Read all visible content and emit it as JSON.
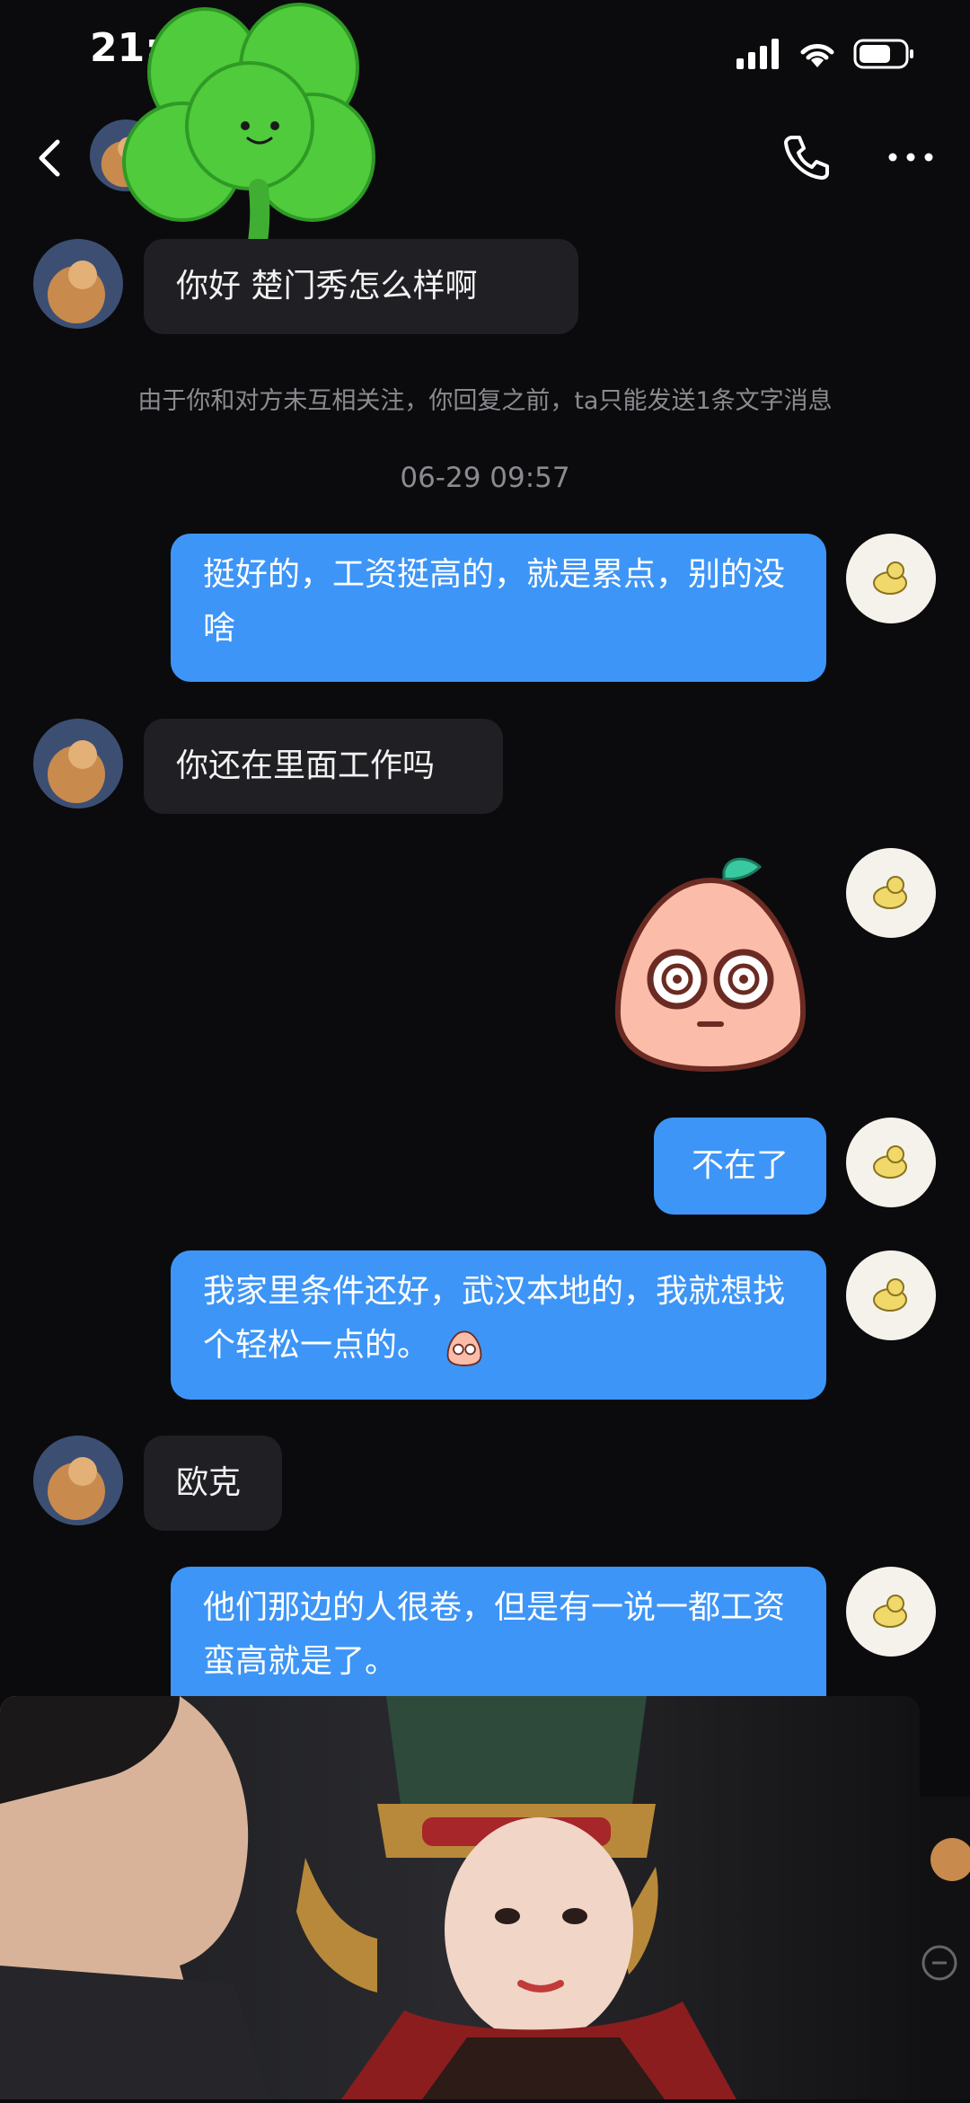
{
  "status_bar": {
    "time": "21:"
  },
  "messages": {
    "incoming_1": "你好 楚门秀怎么样啊",
    "incoming_2": "你还在里面工作吗",
    "incoming_3": "欧克",
    "outgoing_1": "挺好的，工资挺高的，就是累点，别的没啥",
    "outgoing_2": "不在了",
    "outgoing_3": "我家里条件还好，武汉本地的，我就想找个轻松一点的。",
    "outgoing_4": "他们那边的人很卷，但是有一说一都工资蛮高就是了。"
  },
  "system_note": "由于你和对方未互相关注，你回复之前，ta只能发送1条文字消息",
  "timestamp": "06-29 09:57",
  "icons": {
    "back": "back-arrow-icon",
    "phone": "phone-icon",
    "more": "more-dots-icon",
    "sticker": "peach-sticker",
    "clover": "clover-sticker"
  },
  "colors": {
    "background": "#0b0b0d",
    "incoming_bubble": "#1f1f24",
    "outgoing_bubble": "#3d95f7",
    "meta_text": "#8a8a90"
  }
}
